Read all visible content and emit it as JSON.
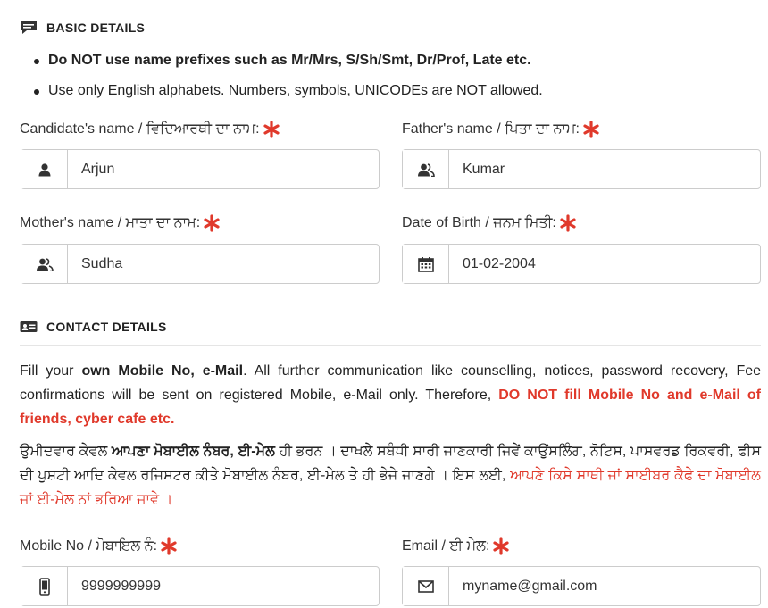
{
  "basic": {
    "title": "BASIC DETAILS",
    "rules": [
      "Do NOT use name prefixes such as Mr/Mrs, S/Sh/Smt, Dr/Prof, Late etc.",
      "Use only English alphabets. Numbers, symbols, UNICODEs are NOT allowed."
    ],
    "candidate_label": "Candidate's name / ਵਿਦਿਆਰਥੀ ਦਾ ਨਾਮ:",
    "candidate_value": "Arjun",
    "father_label": "Father's name / ਪਿਤਾ ਦਾ ਨਾਮ:",
    "father_value": "Kumar",
    "mother_label": "Mother's name / ਮਾਤਾ ਦਾ ਨਾਮ:",
    "mother_value": "Sudha",
    "dob_label": "Date of Birth / ਜਨਮ ਮਿਤੀ:",
    "dob_value": "01-02-2004"
  },
  "contact": {
    "title": "CONTACT DETAILS",
    "en_p1": "Fill your ",
    "en_b1": "own Mobile No, e-Mail",
    "en_p2": ". All further communication like counselling, notices, password recovery, Fee confirmations will be sent on registered Mobile, e-Mail only. Therefore, ",
    "en_warn": "DO NOT fill Mobile No and e-Mail of friends, cyber cafe etc.",
    "pa_p1": "ਉਮੀਦਵਾਰ ਕੇਵਲ ",
    "pa_b1": "ਆਪਣਾ ਮੋਬਾਈਲ ਨੰਬਰ, ਈ-ਮੇਲ",
    "pa_p2": " ਹੀ ਭਰਨ । ਦਾਖਲੇ ਸਬੰਧੀ ਸਾਰੀ ਜਾਣਕਾਰੀ ਜਿਵੇਂ ਕਾਉਂਸਲਿੰਗ, ਨੋਟਿਸ, ਪਾਸਵਰਡ ਰਿਕਵਰੀ, ਫੀਸ ਦੀ ਪੁਸ਼ਟੀ ਆਦਿ ਕੇਵਲ ਰਜਿਸਟਰ ਕੀਤੇ ਮੋਬਾਈਲ ਨੰਬਰ, ਈ-ਮੇਲ ਤੇ ਹੀ ਭੇਜੇ ਜਾਣਗੇ । ਇਸ ਲਈ, ",
    "pa_warn": "ਆਪਣੇ ਕਿਸੇ ਸਾਥੀ ਜਾਂ ਸਾਈਬਰ ਕੈਫੇ ਦਾ ਮੋਬਾਈਲ ਜਾਂ ਈ-ਮੇਲ ਨਾਂ ਭਰਿਆ ਜਾਵੇ ।",
    "mobile_label": "Mobile No / ਮੋਬਾਇਲ ਨੰ:",
    "mobile_value": "9999999999",
    "email_label": "Email / ਈ ਮੇਲ:",
    "email_value": "myname@gmail.com"
  },
  "colors": {
    "required_star": "#e0392b",
    "warning": "#e0392b",
    "border": "#cccccc"
  },
  "icons": {
    "basic_header": "comment-icon",
    "contact_header": "id-card-icon",
    "candidate": "user-icon",
    "father": "user-outline-icon",
    "mother": "user-outline-icon",
    "dob": "calendar-icon",
    "mobile": "mobile-phone-icon",
    "email": "envelope-icon"
  }
}
